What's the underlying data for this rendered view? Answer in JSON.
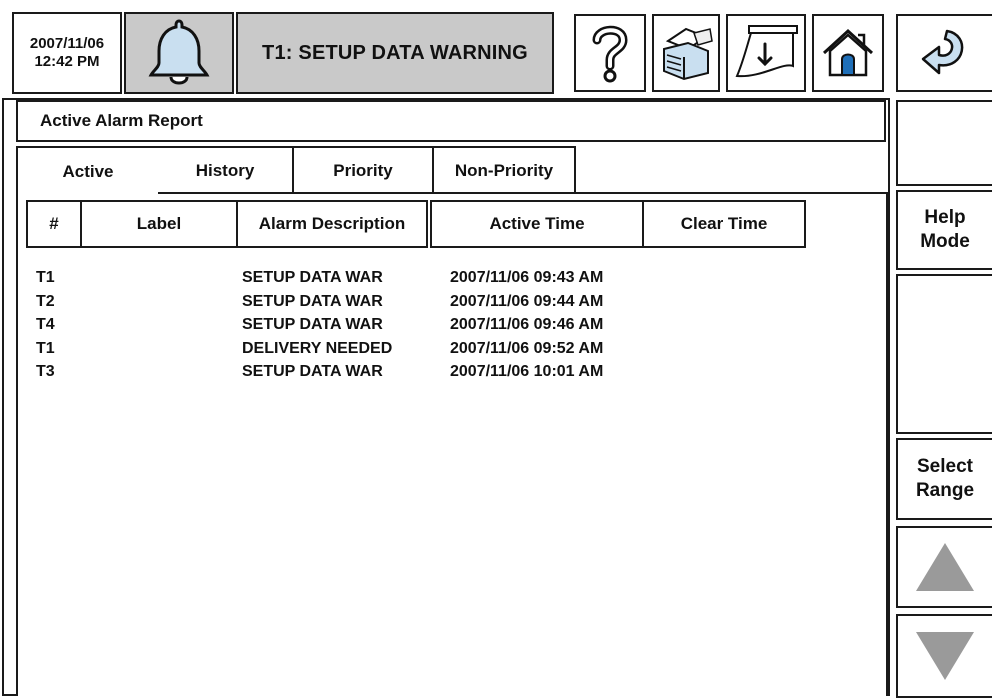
{
  "header": {
    "date": "2007/11/06",
    "time": "12:42 PM",
    "warning_text": "T1: SETUP DATA WARNING",
    "icons": [
      "bell-icon",
      "help-icon",
      "printer-icon",
      "download-icon",
      "home-icon",
      "back-arrow-icon"
    ]
  },
  "report": {
    "title": "Active Alarm Report",
    "tabs": [
      "Active",
      "History",
      "Priority",
      "Non-Priority"
    ],
    "selected_tab": "Active",
    "columns": [
      "#",
      "Label",
      "Alarm Description",
      "Active Time",
      "Clear Time"
    ],
    "rows": [
      {
        "num": "T1",
        "label": "",
        "description": "SETUP DATA WAR",
        "active_time": "2007/11/06 09:43 AM",
        "clear_time": ""
      },
      {
        "num": "T2",
        "label": "",
        "description": "SETUP DATA WAR",
        "active_time": "2007/11/06 09:44 AM",
        "clear_time": ""
      },
      {
        "num": "T4",
        "label": "",
        "description": "SETUP DATA WAR",
        "active_time": "2007/11/06 09:46 AM",
        "clear_time": ""
      },
      {
        "num": "T1",
        "label": "",
        "description": "DELIVERY NEEDED",
        "active_time": "2007/11/06 09:52 AM",
        "clear_time": ""
      },
      {
        "num": "T3",
        "label": "",
        "description": "SETUP DATA WAR",
        "active_time": "2007/11/06 10:01 AM",
        "clear_time": ""
      }
    ]
  },
  "sidebar": {
    "help_mode": [
      "Help",
      "Mode"
    ],
    "select_range": [
      "Select",
      "Range"
    ],
    "icons": [
      "scroll-up-icon",
      "scroll-down-icon"
    ]
  },
  "colors": {
    "banner_bg": "#c9c9c9",
    "border": "#1a1a1a",
    "arrow_gray": "#9a9a9a",
    "icon_blue": "#c9dff0",
    "home_door_blue": "#1f6fb8"
  }
}
